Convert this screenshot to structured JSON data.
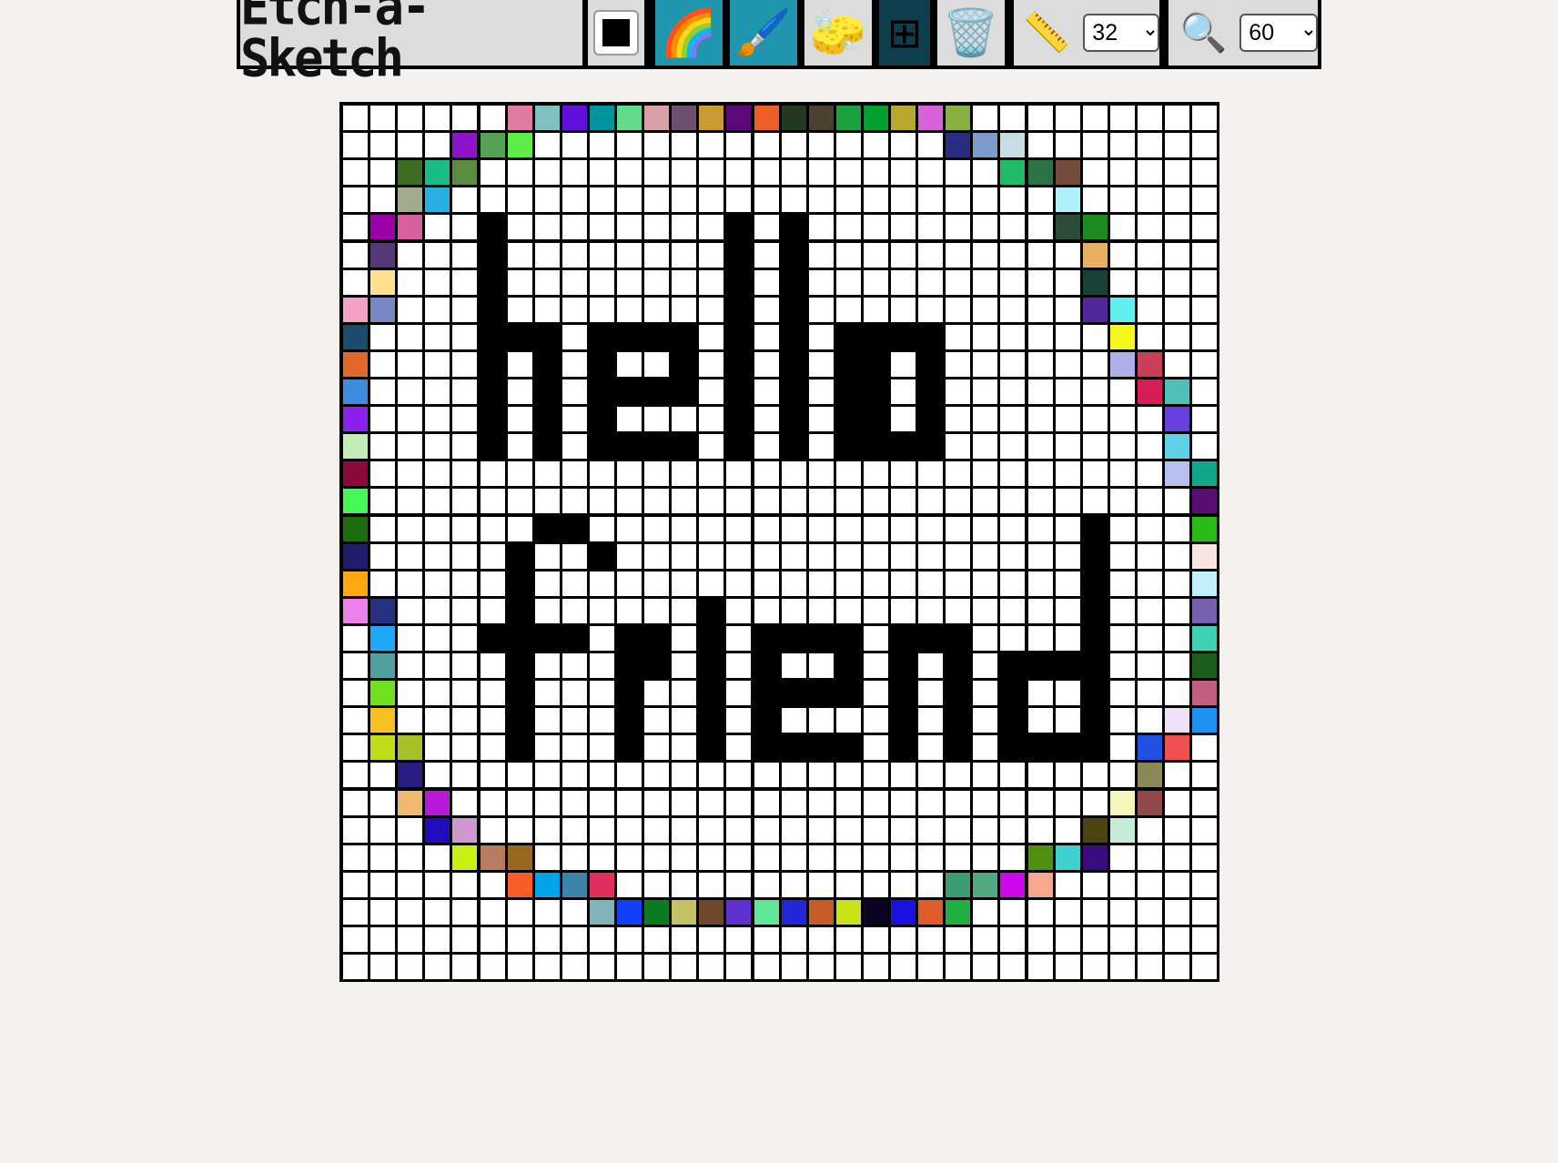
{
  "app": {
    "title": "Etch-a-Sketch"
  },
  "toolbar": {
    "current_color": "#000000",
    "tools": [
      {
        "name": "color-picker",
        "icon": "color-swatch-icon"
      },
      {
        "name": "rainbow-mode",
        "icon": "rainbow-icon",
        "glyph": "🌈",
        "active": true
      },
      {
        "name": "brush-mode",
        "icon": "paintbrush-icon",
        "glyph": "🖌️",
        "active": true
      },
      {
        "name": "eraser",
        "icon": "sponge-icon",
        "glyph": "🧽"
      },
      {
        "name": "grid-toggle",
        "icon": "grid-icon",
        "glyph": "⊞",
        "active": true
      },
      {
        "name": "clear",
        "icon": "trash-icon",
        "glyph": "🗑️"
      }
    ],
    "size": {
      "icon": "ruler-icon",
      "glyph": "📏",
      "value": "32",
      "options": [
        "32"
      ]
    },
    "zoom": {
      "icon": "magnifier-icon",
      "glyph": "🔍",
      "value": "60",
      "options": [
        "60"
      ]
    }
  },
  "canvas": {
    "cells_per_side": 32,
    "rows": [
      "......ABCDEFGHIJKLMNOPQ.........",
      "...........................",
      "..",
      "..",
      "",
      "",
      "",
      "",
      "",
      "",
      "",
      "",
      "",
      "",
      "",
      "",
      "",
      "",
      "",
      "",
      "",
      "",
      "",
      "",
      "",
      "",
      "",
      "",
      "",
      "",
      "",
      ""
    ],
    "pixels": {
      "black_text": "hello friend",
      "filled": [
        [
          0,
          6,
          "#df7aa0"
        ],
        [
          0,
          7,
          "#80c0c0"
        ],
        [
          0,
          8,
          "#6010d8"
        ],
        [
          0,
          9,
          "#00949c"
        ],
        [
          0,
          10,
          "#60dc8c"
        ],
        [
          0,
          11,
          "#d8a0a8"
        ],
        [
          0,
          12,
          "#6c5070"
        ],
        [
          0,
          13,
          "#c89c30"
        ],
        [
          0,
          14,
          "#5c0878"
        ],
        [
          0,
          15,
          "#ef6028"
        ],
        [
          0,
          16,
          "#243820"
        ],
        [
          0,
          17,
          "#4c4030"
        ],
        [
          0,
          18,
          "#1ca040"
        ],
        [
          0,
          19,
          "#00a030"
        ],
        [
          0,
          20,
          "#b8a830"
        ],
        [
          0,
          21,
          "#d860d8"
        ],
        [
          0,
          22,
          "#88b040"
        ],
        [
          1,
          4,
          "#8c14c8"
        ],
        [
          1,
          5,
          "#58a058"
        ],
        [
          1,
          6,
          "#60ec48"
        ],
        [
          1,
          22,
          "#2c2c80"
        ],
        [
          1,
          23,
          "#7c9cc8"
        ],
        [
          1,
          24,
          "#c8dce4"
        ],
        [
          2,
          2,
          "#3c6c20"
        ],
        [
          2,
          3,
          "#18bc84"
        ],
        [
          2,
          4,
          "#5c8c40"
        ],
        [
          2,
          24,
          "#20bc68"
        ],
        [
          2,
          25,
          "#2c7448"
        ],
        [
          2,
          26,
          "#744c3c"
        ],
        [
          3,
          2,
          "#a4ac90"
        ],
        [
          3,
          3,
          "#28b0e0"
        ],
        [
          3,
          26,
          "#b0f0f8"
        ],
        [
          4,
          1,
          "#9c00a8"
        ],
        [
          4,
          2,
          "#d860a0"
        ],
        [
          4,
          26,
          "#2c4c38"
        ],
        [
          4,
          27,
          "#1c8c20"
        ],
        [
          5,
          1,
          "#543878"
        ],
        [
          5,
          27,
          "#e8b060"
        ],
        [
          6,
          1,
          "#ffe090"
        ],
        [
          6,
          27,
          "#184034"
        ],
        [
          7,
          0,
          "#f4a0c8"
        ],
        [
          7,
          1,
          "#7888c4"
        ],
        [
          7,
          27,
          "#50289c"
        ],
        [
          7,
          28,
          "#60f0f0"
        ],
        [
          8,
          0,
          "#1c4c6c"
        ],
        [
          8,
          28,
          "#f8f81c"
        ],
        [
          9,
          0,
          "#e06828"
        ],
        [
          9,
          28,
          "#b0b0e8"
        ],
        [
          9,
          29,
          "#c84058"
        ],
        [
          10,
          0,
          "#3c8ce0"
        ],
        [
          10,
          29,
          "#d81c58"
        ],
        [
          10,
          30,
          "#50c0b8"
        ],
        [
          11,
          0,
          "#8c20ec"
        ],
        [
          11,
          30,
          "#6840e0"
        ],
        [
          12,
          0,
          "#c4ecb8"
        ],
        [
          12,
          30,
          "#60d0e8"
        ],
        [
          13,
          0,
          "#8c0838"
        ],
        [
          13,
          30,
          "#b8c0f0"
        ],
        [
          13,
          31,
          "#10a888"
        ],
        [
          14,
          0,
          "#44f858"
        ],
        [
          14,
          31,
          "#580c74"
        ],
        [
          15,
          0,
          "#1c6c10"
        ],
        [
          15,
          31,
          "#2cb818"
        ],
        [
          16,
          0,
          "#201c6c"
        ],
        [
          16,
          31,
          "#f8e4e0"
        ],
        [
          17,
          0,
          "#ffa814"
        ],
        [
          17,
          31,
          "#c0f0f8"
        ],
        [
          18,
          0,
          "#ec80ec"
        ],
        [
          18,
          1,
          "#283080"
        ],
        [
          18,
          31,
          "#7860b0"
        ],
        [
          19,
          1,
          "#20a8f8"
        ],
        [
          19,
          31,
          "#40d0b4"
        ],
        [
          20,
          1,
          "#50a0a0"
        ],
        [
          20,
          31,
          "#1c5c1c"
        ],
        [
          21,
          1,
          "#70e020"
        ],
        [
          21,
          31,
          "#c06080"
        ],
        [
          22,
          1,
          "#f8c020"
        ],
        [
          22,
          30,
          "#f0e0f8"
        ],
        [
          22,
          31,
          "#2090f0"
        ],
        [
          23,
          1,
          "#c0dc18"
        ],
        [
          23,
          2,
          "#a8c028"
        ],
        [
          23,
          29,
          "#2050e0"
        ],
        [
          23,
          30,
          "#f05050"
        ],
        [
          24,
          2,
          "#281c80"
        ],
        [
          24,
          29,
          "#888858"
        ],
        [
          25,
          2,
          "#f0b870"
        ],
        [
          25,
          3,
          "#b818d8"
        ],
        [
          25,
          28,
          "#f4f8b8"
        ],
        [
          25,
          29,
          "#904848"
        ],
        [
          26,
          3,
          "#200cbc"
        ],
        [
          26,
          4,
          "#d098d0"
        ],
        [
          26,
          27,
          "#4c4410"
        ],
        [
          26,
          28,
          "#c4ecd8"
        ],
        [
          27,
          4,
          "#c8f010"
        ],
        [
          27,
          5,
          "#b87c60"
        ],
        [
          27,
          6,
          "#986820"
        ],
        [
          27,
          25,
          "#509010"
        ],
        [
          27,
          26,
          "#40d0d0"
        ],
        [
          27,
          27,
          "#380c7c"
        ],
        [
          28,
          6,
          "#f85c28"
        ],
        [
          28,
          7,
          "#00a4e8"
        ],
        [
          28,
          8,
          "#3c84a8"
        ],
        [
          28,
          9,
          "#e03060"
        ],
        [
          28,
          22,
          "#3c9c70"
        ],
        [
          28,
          23,
          "#50a880"
        ],
        [
          28,
          24,
          "#cc08ec"
        ],
        [
          28,
          25,
          "#f8a890"
        ],
        [
          29,
          9,
          "#80b4b8"
        ],
        [
          29,
          10,
          "#1040f8"
        ],
        [
          29,
          11,
          "#0c7c24"
        ],
        [
          29,
          12,
          "#c4c068"
        ],
        [
          29,
          13,
          "#70482c"
        ],
        [
          29,
          14,
          "#6030d0"
        ],
        [
          29,
          15,
          "#60e898"
        ],
        [
          29,
          16,
          "#2424d8"
        ],
        [
          29,
          17,
          "#c85c28"
        ],
        [
          29,
          18,
          "#c8e418"
        ],
        [
          29,
          19,
          "#0c0424"
        ],
        [
          29,
          20,
          "#1c10e0"
        ],
        [
          29,
          21,
          "#e05c28"
        ],
        [
          29,
          22,
          "#20b040"
        ]
      ]
    }
  }
}
